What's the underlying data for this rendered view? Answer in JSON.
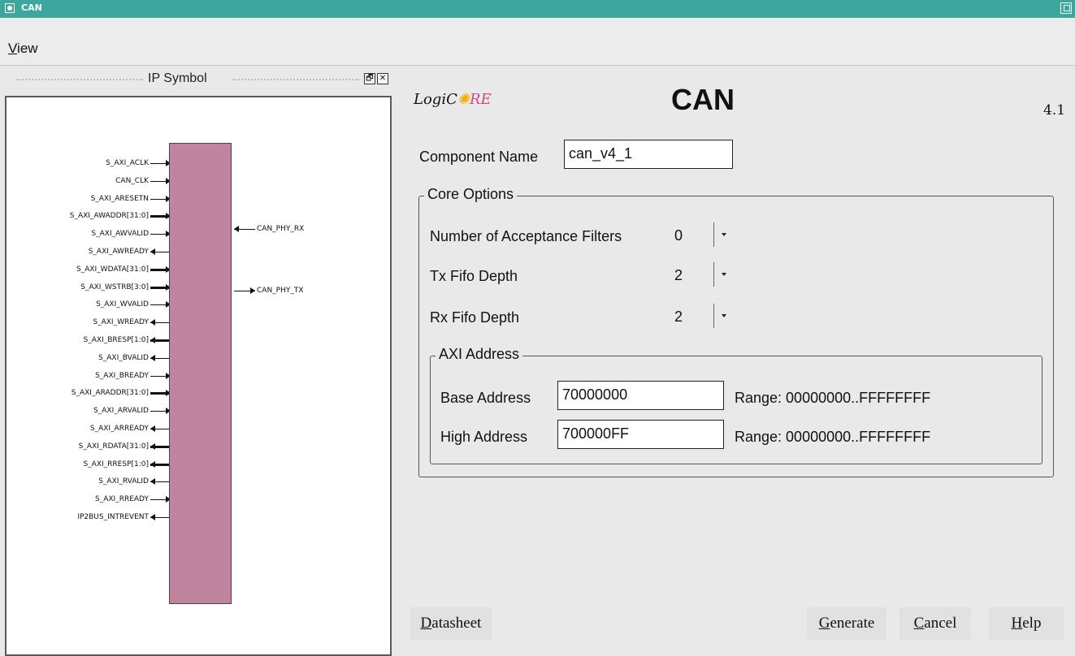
{
  "window": {
    "title": "CAN"
  },
  "menu": {
    "view_mn": "V",
    "view_rest": "iew"
  },
  "ip_symbol": {
    "title": "IP Symbol",
    "float_glyph": "🗗",
    "close_glyph": "✕",
    "left_ports": [
      {
        "name": "S_AXI_ACLK",
        "dir": "in",
        "bus": false
      },
      {
        "name": "CAN_CLK",
        "dir": "in",
        "bus": false
      },
      {
        "name": "S_AXI_ARESETN",
        "dir": "in",
        "bus": false
      },
      {
        "name": "S_AXI_AWADDR[31:0]",
        "dir": "in",
        "bus": true
      },
      {
        "name": "S_AXI_AWVALID",
        "dir": "in",
        "bus": false
      },
      {
        "name": "S_AXI_AWREADY",
        "dir": "out",
        "bus": false
      },
      {
        "name": "S_AXI_WDATA[31:0]",
        "dir": "in",
        "bus": true
      },
      {
        "name": "S_AXI_WSTRB[3:0]",
        "dir": "in",
        "bus": true
      },
      {
        "name": "S_AXI_WVALID",
        "dir": "in",
        "bus": false
      },
      {
        "name": "S_AXI_WREADY",
        "dir": "out",
        "bus": false
      },
      {
        "name": "S_AXI_BRESP[1:0]",
        "dir": "out",
        "bus": true
      },
      {
        "name": "S_AXI_BVALID",
        "dir": "out",
        "bus": false
      },
      {
        "name": "S_AXI_BREADY",
        "dir": "in",
        "bus": false
      },
      {
        "name": "S_AXI_ARADDR[31:0]",
        "dir": "in",
        "bus": true
      },
      {
        "name": "S_AXI_ARVALID",
        "dir": "in",
        "bus": false
      },
      {
        "name": "S_AXI_ARREADY",
        "dir": "out",
        "bus": false
      },
      {
        "name": "S_AXI_RDATA[31:0]",
        "dir": "out",
        "bus": true
      },
      {
        "name": "S_AXI_RRESP[1:0]",
        "dir": "out",
        "bus": true
      },
      {
        "name": "S_AXI_RVALID",
        "dir": "out",
        "bus": false
      },
      {
        "name": "S_AXI_RREADY",
        "dir": "in",
        "bus": false
      },
      {
        "name": "IP2BUS_INTREVENT",
        "dir": "out",
        "bus": false
      }
    ],
    "right_ports": [
      {
        "name": "CAN_PHY_RX",
        "dir": "in",
        "bus": false
      },
      {
        "name": "CAN_PHY_TX",
        "dir": "out",
        "bus": false
      }
    ]
  },
  "logo": {
    "part1": "LogiC",
    "star": "✺",
    "part2": "RE"
  },
  "core": {
    "title": "CAN",
    "version": "4.1"
  },
  "component": {
    "label": "Component Name",
    "value": "can_v4_1"
  },
  "core_options": {
    "legend": "Core Options",
    "acceptance_filters": {
      "label": "Number of Acceptance Filters",
      "value": "0"
    },
    "tx_fifo": {
      "label": "Tx Fifo Depth",
      "value": "2"
    },
    "rx_fifo": {
      "label": "Rx Fifo Depth",
      "value": "2"
    }
  },
  "axi_address": {
    "legend": "AXI Address",
    "base": {
      "label": "Base Address",
      "value": "70000000",
      "range": "Range: 00000000..FFFFFFFF"
    },
    "high": {
      "label": "High Address",
      "value": "700000FF",
      "range": "Range: 00000000..FFFFFFFF"
    }
  },
  "buttons": {
    "datasheet": {
      "mn": "D",
      "rest": "atasheet"
    },
    "generate": {
      "mn": "G",
      "rest": "enerate"
    },
    "cancel": {
      "mn": "C",
      "rest": "ancel"
    },
    "help": {
      "mn": "H",
      "rest": "elp"
    }
  }
}
